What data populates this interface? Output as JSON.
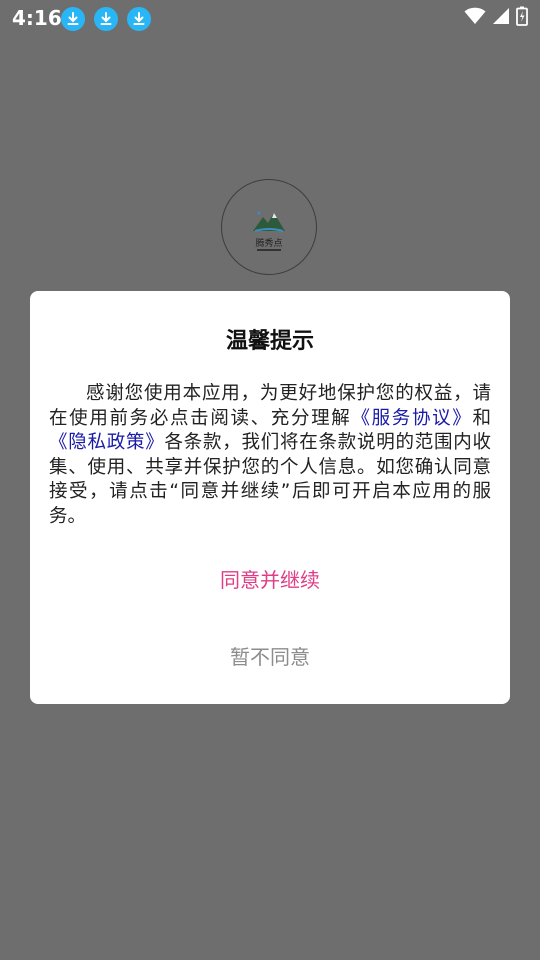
{
  "status_bar": {
    "time": "4:16",
    "notifications": [
      "download-icon",
      "download-icon",
      "download-icon"
    ],
    "accent": "#29b6f6"
  },
  "splash": {
    "logo_text": "腾秀点"
  },
  "dialog": {
    "title": "温馨提示",
    "body_part1": "感谢您使用本应用，为更好地保护您的权益，请在使用前务必点击阅读、充分理解",
    "link_service": "《服务协议》",
    "body_and": "和",
    "link_privacy": "《隐私政策》",
    "body_part2": "各条款，我们将在条款说明的范围内收集、使用、共享并保护您的个人信息。如您确认同意接受，请点击“同意并继续”后即可开启本应用的服务。",
    "agree_label": "同意并继续",
    "decline_label": "暂不同意",
    "colors": {
      "agree": "#e03d86",
      "decline": "#8c8c8c",
      "link": "#1a1aa8"
    }
  }
}
